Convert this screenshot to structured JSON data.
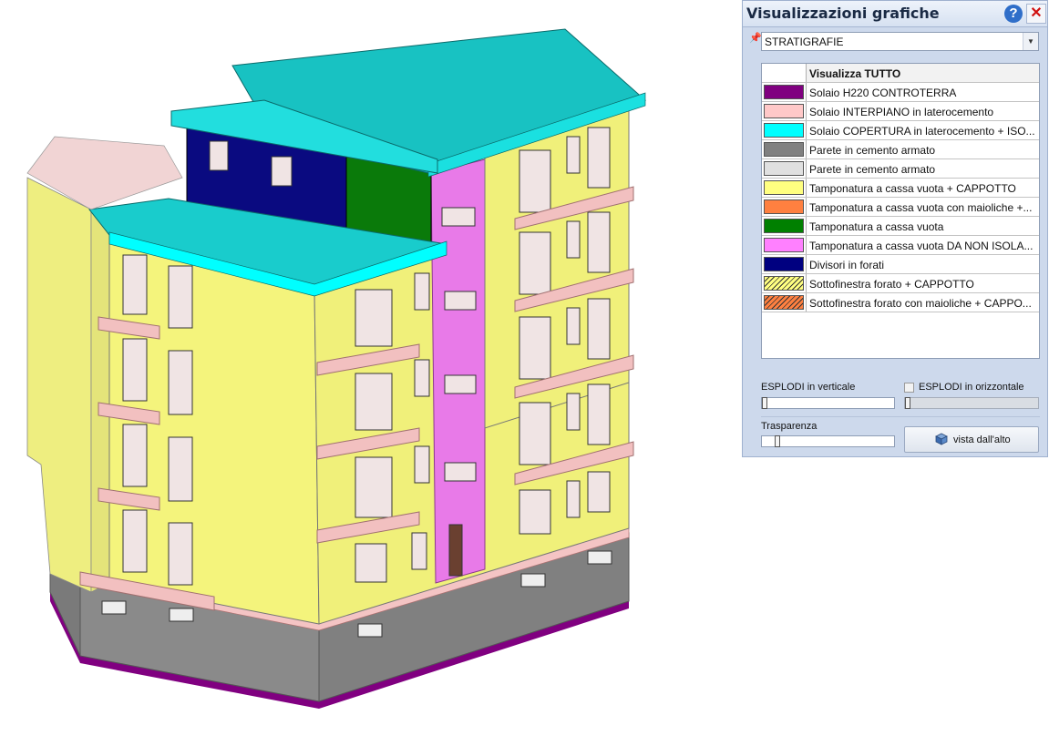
{
  "panel": {
    "title": "Visualizzazioni grafiche",
    "help_icon": "?",
    "close_icon": "✕",
    "pin_icon": "pin-icon",
    "view_select": {
      "value": "STRATIGRAFIE",
      "arrow": "▼"
    }
  },
  "layers": {
    "header": "Visualizza TUTTO",
    "items": [
      {
        "label": "Solaio H220 CONTROTERRA",
        "color": "#800080",
        "pattern": "solid"
      },
      {
        "label": "Solaio INTERPIANO in laterocemento",
        "color": "#ffc8c8",
        "pattern": "solid"
      },
      {
        "label": "Solaio COPERTURA  in laterocemento + ISO...",
        "color": "#00ffff",
        "pattern": "solid"
      },
      {
        "label": "Parete in cemento armato",
        "color": "#808080",
        "pattern": "solid"
      },
      {
        "label": "Parete in cemento armato",
        "color": "#e0e0e0",
        "pattern": "solid"
      },
      {
        "label": "Tamponatura a cassa vuota + CAPPOTTO",
        "color": "#ffff80",
        "pattern": "solid"
      },
      {
        "label": "Tamponatura a cassa vuota con maioliche +...",
        "color": "#ff8040",
        "pattern": "solid"
      },
      {
        "label": "Tamponatura a cassa vuota",
        "color": "#008000",
        "pattern": "solid"
      },
      {
        "label": "Tamponatura a cassa vuota DA NON ISOLA...",
        "color": "#ff80ff",
        "pattern": "solid"
      },
      {
        "label": "Divisori in forati",
        "color": "#000080",
        "pattern": "solid"
      },
      {
        "label": "Sottofinestra forato + CAPPOTTO",
        "color": "#ffff80",
        "pattern": "hatch"
      },
      {
        "label": "Sottofinestra forato con maioliche + CAPPO...",
        "color": "#ff8040",
        "pattern": "hatch"
      }
    ]
  },
  "controls": {
    "esplodi_verticale": {
      "label": "ESPLODI in verticale",
      "value": 0
    },
    "esplodi_orizzontale": {
      "label": "ESPLODI in orizzontale",
      "checked": false,
      "enabled": false,
      "value": 0
    },
    "trasparenza": {
      "label": "Trasparenza",
      "value": 0.1
    },
    "top_view_button": {
      "label": "vista dall'alto",
      "icon": "cube-icon"
    }
  }
}
